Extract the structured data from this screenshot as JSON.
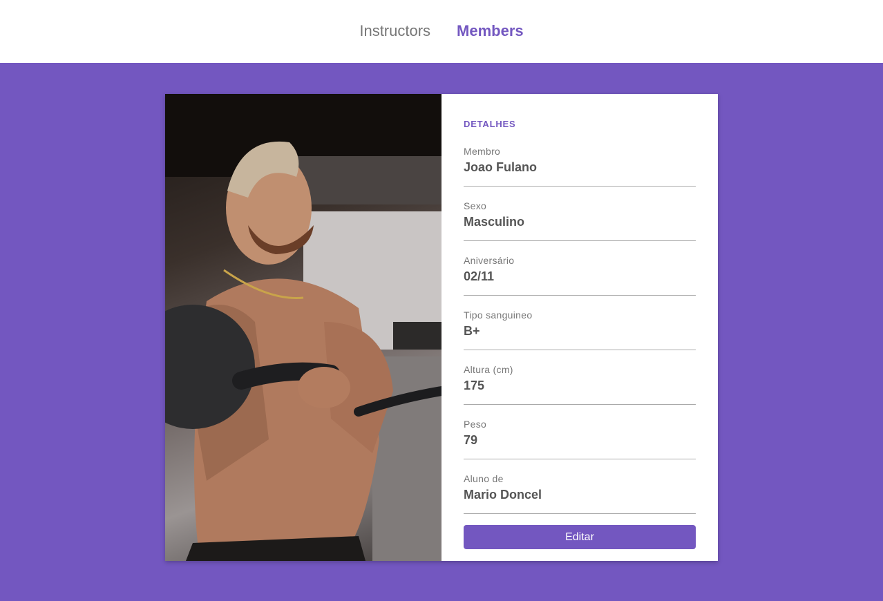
{
  "nav": {
    "links": [
      {
        "label": "Instructors",
        "active": false
      },
      {
        "label": "Members",
        "active": true
      }
    ]
  },
  "colors": {
    "accent": "#7357c0",
    "background": "#7357c0"
  },
  "card": {
    "photo": {
      "icon": "member-photo"
    },
    "section_title": "DETALHES",
    "fields": [
      {
        "label": "Membro",
        "value": "Joao Fulano"
      },
      {
        "label": "Sexo",
        "value": "Masculino"
      },
      {
        "label": "Aniversário",
        "value": "02/11"
      },
      {
        "label": "Tipo sanguineo",
        "value": "B+"
      },
      {
        "label": "Altura (cm)",
        "value": "175"
      },
      {
        "label": "Peso",
        "value": "79"
      },
      {
        "label": "Aluno de",
        "value": "Mario Doncel"
      }
    ],
    "edit_label": "Editar"
  }
}
